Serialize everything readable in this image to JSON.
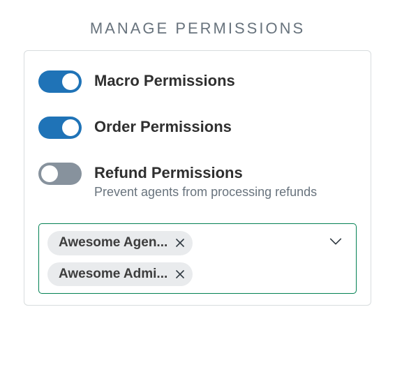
{
  "title": "MANAGE PERMISSIONS",
  "items": [
    {
      "label": "Macro Permissions",
      "enabled": true,
      "description": null
    },
    {
      "label": "Order Permissions",
      "enabled": true,
      "description": null
    },
    {
      "label": "Refund Permissions",
      "enabled": false,
      "description": "Prevent agents from processing refunds"
    }
  ],
  "select": {
    "tags": [
      {
        "label": "Awesome Agen..."
      },
      {
        "label": "Awesome Admi..."
      }
    ]
  }
}
